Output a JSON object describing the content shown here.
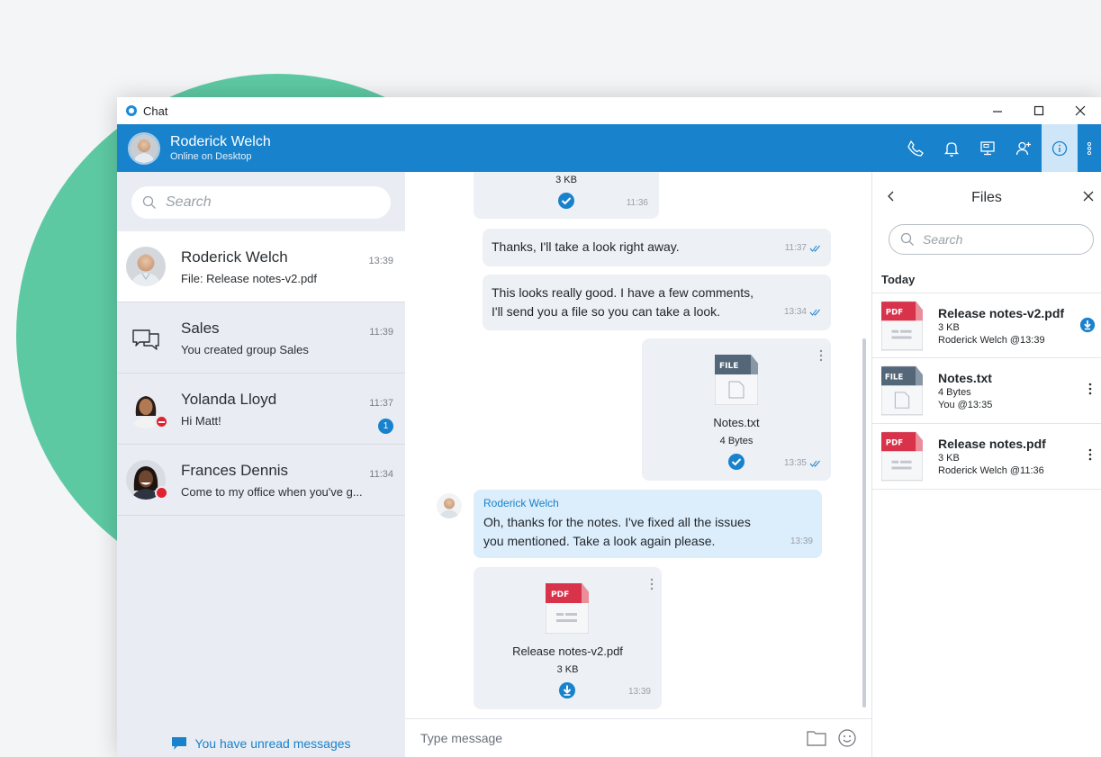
{
  "window": {
    "title": "Chat"
  },
  "header": {
    "name": "Roderick Welch",
    "status": "Online on Desktop",
    "accent": "#1982cc"
  },
  "sidebar": {
    "search_placeholder": "Search",
    "conversations": [
      {
        "name": "Roderick Welch",
        "preview": "File: Release notes-v2.pdf",
        "time": "13:39",
        "selected": true
      },
      {
        "name": "Sales",
        "preview": "You created group Sales",
        "time": "11:39",
        "icon": "group-chat-icon"
      },
      {
        "name": "Yolanda Lloyd",
        "preview": "Hi Matt!",
        "time": "11:37",
        "unread": "1",
        "presence": "do-not-disturb"
      },
      {
        "name": "Frances Dennis",
        "preview": "Come to my office when you've g...",
        "time": "11:34",
        "presence": "busy"
      }
    ],
    "unread_banner": "You have unread messages"
  },
  "chat": {
    "messages": [
      {
        "type": "file-partial",
        "size": "3 KB",
        "time": "11:36",
        "direction": "outgoing"
      },
      {
        "type": "text",
        "text": "Thanks, I'll take a look right away.",
        "time": "11:37",
        "direction": "outgoing"
      },
      {
        "type": "text",
        "lines": [
          "This looks really good. I have a few comments,",
          "I'll send you a file so you can take a look."
        ],
        "time": "13:34",
        "direction": "outgoing"
      },
      {
        "type": "file",
        "badge": "FILE",
        "name": "Notes.txt",
        "size": "4 Bytes",
        "time": "13:35",
        "direction": "outgoing"
      },
      {
        "type": "text",
        "sender": "Roderick Welch",
        "lines": [
          "Oh, thanks for the notes. I've fixed all the issues",
          "you mentioned. Take a look again please."
        ],
        "time": "13:39",
        "direction": "incoming"
      },
      {
        "type": "file",
        "badge": "PDF",
        "name": "Release notes-v2.pdf",
        "size": "3 KB",
        "time": "13:39",
        "direction": "incoming"
      }
    ],
    "composer_placeholder": "Type message"
  },
  "files_panel": {
    "title": "Files",
    "search_placeholder": "Search",
    "section": "Today",
    "items": [
      {
        "badge": "PDF",
        "name": "Release notes-v2.pdf",
        "size": "3 KB",
        "meta": "Roderick Welch @13:39",
        "action": "download-icon"
      },
      {
        "badge": "FILE",
        "name": "Notes.txt",
        "size": "4 Bytes",
        "meta": "You @13:35",
        "action": "more-vertical-icon"
      },
      {
        "badge": "PDF",
        "name": "Release notes.pdf",
        "size": "3 KB",
        "meta": "Roderick Welch @11:36",
        "action": "more-vertical-icon"
      }
    ]
  },
  "colors": {
    "background_circle": "#5dc9a3",
    "pdf_red": "#d8334a",
    "file_gray": "#546778",
    "busy_red": "#e0222e"
  }
}
